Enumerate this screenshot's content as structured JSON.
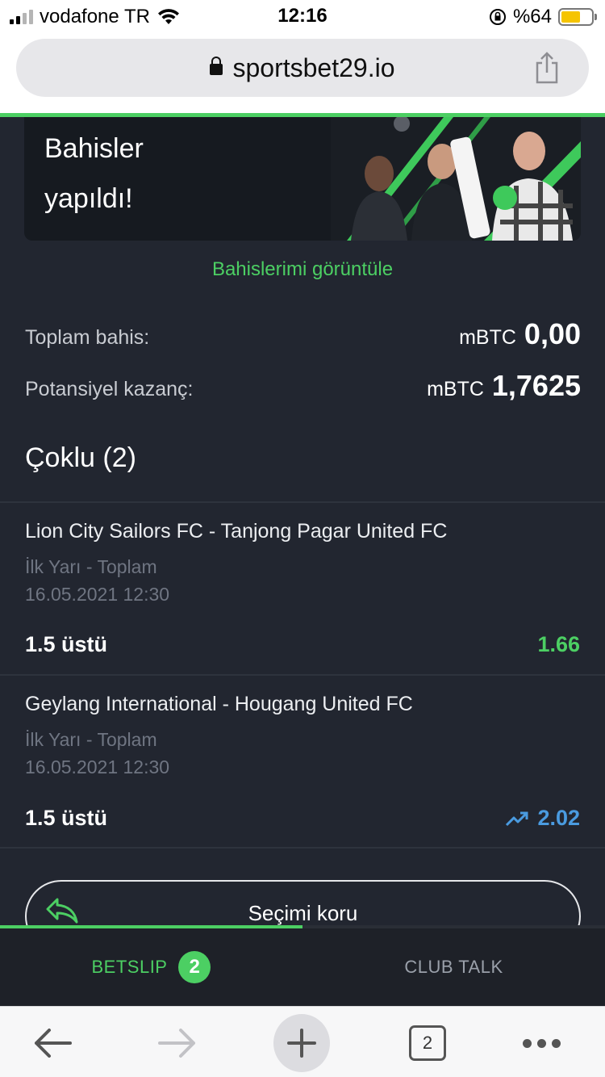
{
  "status_bar": {
    "carrier": "vodafone TR",
    "time": "12:16",
    "battery": "%64",
    "battery_level": 0.64
  },
  "browser": {
    "url": "sportsbet29.io",
    "tab_count": "2"
  },
  "banner": {
    "title": "Bahisler yapıldı!"
  },
  "view_bets_link": "Bahislerimi görüntüle",
  "summary": {
    "total_stake_label": "Toplam bahis:",
    "total_stake_currency": "mBTC",
    "total_stake_value": "0,00",
    "potential_win_label": "Potansiyel kazanç:",
    "potential_win_currency": "mBTC",
    "potential_win_value": "1,7625"
  },
  "combo_title": "Çoklu (2)",
  "bets": [
    {
      "match": "Lion City Sailors FC - Tanjong Pagar United FC",
      "market": "İlk Yarı - Toplam",
      "datetime": "16.05.2021 12:30",
      "pick": "1.5 üstü",
      "odds": "1.66",
      "odds_color": "#4ccf63"
    },
    {
      "match": "Geylang International - Hougang United FC",
      "market": "İlk Yarı - Toplam",
      "datetime": "16.05.2021 12:30",
      "pick": "1.5 üstü",
      "odds": "2.02",
      "odds_color": "#4a9be0",
      "odds_trend_icon": "trend-up-icon"
    }
  ],
  "keep_selection_button": "Seçimi koru",
  "tabs": {
    "betslip_label": "BETSLIP",
    "betslip_count": "2",
    "club_talk_label": "CLUB TALK"
  },
  "colors": {
    "accent_green": "#4ccf63",
    "background": "#222630",
    "odds_up_blue": "#4a9be0"
  }
}
